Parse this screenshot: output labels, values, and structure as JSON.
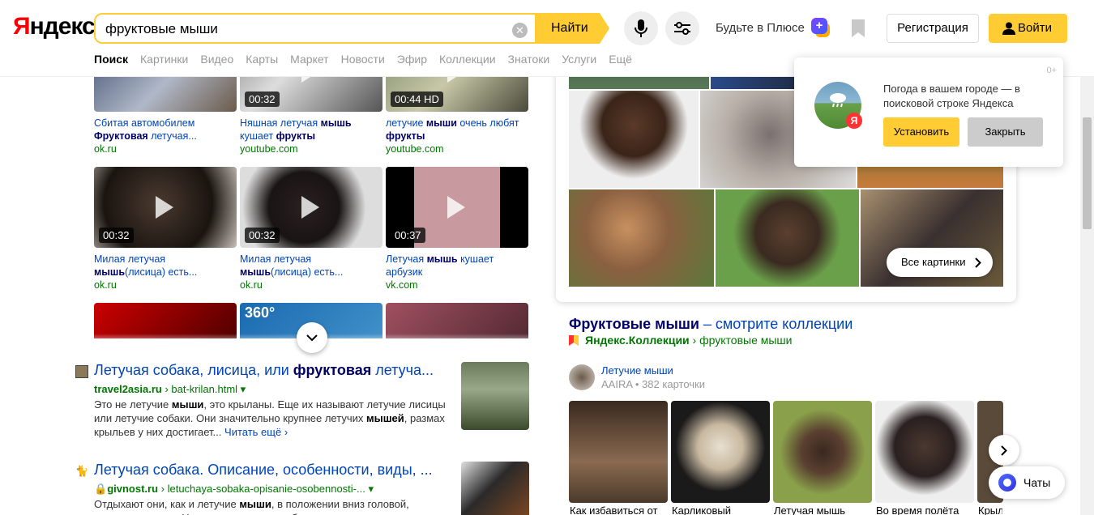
{
  "header": {
    "logo": "Яндекс",
    "search_value": "фруктовые мыши",
    "find_label": "Найти",
    "plus_label": "Будьте в Плюсе",
    "register_label": "Регистрация",
    "login_label": "Войти"
  },
  "nav": [
    "Поиск",
    "Картинки",
    "Видео",
    "Карты",
    "Маркет",
    "Новости",
    "Эфир",
    "Коллекции",
    "Знатоки",
    "Услуги",
    "Ещё"
  ],
  "videos": [
    {
      "dur": "",
      "t1": "Сбитая автомобилем ",
      "b1": "Фруктовая",
      "t2": " летучая...",
      "host": "ok.ru"
    },
    {
      "dur": "00:32",
      "t1": "Няшная летучая ",
      "b1": "мышь",
      "t2": " кушает ",
      "b2": "фрукты",
      "host": "youtube.com"
    },
    {
      "dur": "00:44 HD",
      "t1": "летучие ",
      "b1": "мыши",
      "t2": " очень любят ",
      "b2": "фрукты",
      "host": "youtube.com"
    },
    {
      "dur": "00:32",
      "t1": "Милая летучая ",
      "b1": "мышь",
      "t2": "(лисица) есть...",
      "host": "ok.ru"
    },
    {
      "dur": "00:32",
      "t1": "Милая летучая ",
      "b1": "мышь",
      "t2": "(лисица) есть...",
      "host": "ok.ru"
    },
    {
      "dur": "00:37",
      "t1": "Летучая ",
      "b1": "мышь",
      "t2": " кушает арбузик",
      "host": "vk.com"
    }
  ],
  "results": [
    {
      "title_a": "Летучая собака, лисица, или ",
      "title_b": "фруктовая",
      "title_c": " летуча...",
      "site": "travel2asia.ru",
      "path": " › bat-krilan.html ▾",
      "text_html": "Это не летучие <b>мыши</b>, это крыланы. Еще их называют летучие лисицы или летучие собаки. Они значительно крупнее летучих <b>мышей</b>, размах крыльев у них достигает...",
      "more": "Читать ещё ›"
    },
    {
      "title_a": "Летучая собака. Описание, особенности, виды, ...",
      "title_b": "",
      "title_c": "",
      "site": "givnost.ru",
      "path": " › letuchaya-sobaka-opisanie-osobennosti-... ▾",
      "text_html": "Отдыхают они, как и летучие <b>мыши</b>, в положении вниз головой, прикрепившись... Ныль ских крыланов обычно кормят компотом..."
    }
  ],
  "images": {
    "all_label": "Все картинки"
  },
  "collection": {
    "title_a": "Фруктовые мыши",
    "title_b": " – смотрите коллекции",
    "source": "Яндекс.Коллекции",
    "crumb": " › фруктовые мыши",
    "author": "Летучие мыши",
    "owner": "AAIRA",
    "count": "382 карточки",
    "cards": [
      "Как избавиться от",
      "Карликовый",
      "Летучая мышь",
      "Во время полёта",
      "Крыл"
    ]
  },
  "popup": {
    "age": "0+",
    "text": "Погода в вашем городе — в поисковой строке Яндекса",
    "install": "Установить",
    "close": "Закрыть"
  },
  "chats_label": "Чаты",
  "colors": {
    "accent": "#ffcc33",
    "link": "#0044bb",
    "url_green": "#007700"
  }
}
